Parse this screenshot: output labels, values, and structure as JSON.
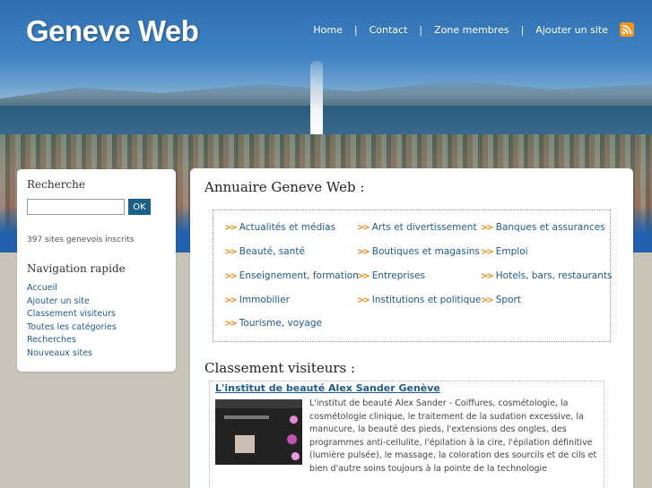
{
  "header": {
    "logo": "Geneve Web",
    "nav": [
      "Home",
      "Contact",
      "Zone membres",
      "Ajouter un site"
    ],
    "separator": "|"
  },
  "sidebar": {
    "search_title": "Recherche",
    "search_value": "",
    "search_button": "OK",
    "count_text": "397 sites genevois inscrits",
    "nav_title": "Navigation rapide",
    "links": [
      "Accueil",
      "Ajouter un site",
      "Classement visiteurs",
      "Toutes les catégories",
      "Recherches",
      "Nouveaux sites"
    ]
  },
  "main": {
    "directory_title": "Annuaire Geneve Web :",
    "arrow": ">>",
    "categories": [
      "Actualités et médias",
      "Arts et divertissement",
      "Banques et assurances",
      "Beauté, santé",
      "Boutiques et magasins",
      "Emploi",
      "Enseignement, formation",
      "Entreprises",
      "Hotels, bars, restaurants",
      "Immobilier",
      "Institutions et politique",
      "Sport",
      "Tourisme, voyage"
    ],
    "ranking_title": "Classement visiteurs :",
    "site": {
      "title": "L'institut de beauté Alex Sander Genève",
      "description": "L'institut de beauté Alex Sander - Coiffures, cosmétologie, la cosmétologie clinique, le traitement de la sudation excessive, la manucure, la beauté des pieds, l'extensions des ongles, des programmes anti-cellulite, l'épilation à la cire, l'épilation définitive (lumière pulsée), le massage, la coloration des sourcils et de cils et bien d'autre soins toujours à la pointe de la technologie"
    }
  },
  "colors": {
    "accent": "#1f5a8a",
    "arrow": "#f08a1a",
    "rss": "#f7941d",
    "button": "#1b5f8b"
  }
}
